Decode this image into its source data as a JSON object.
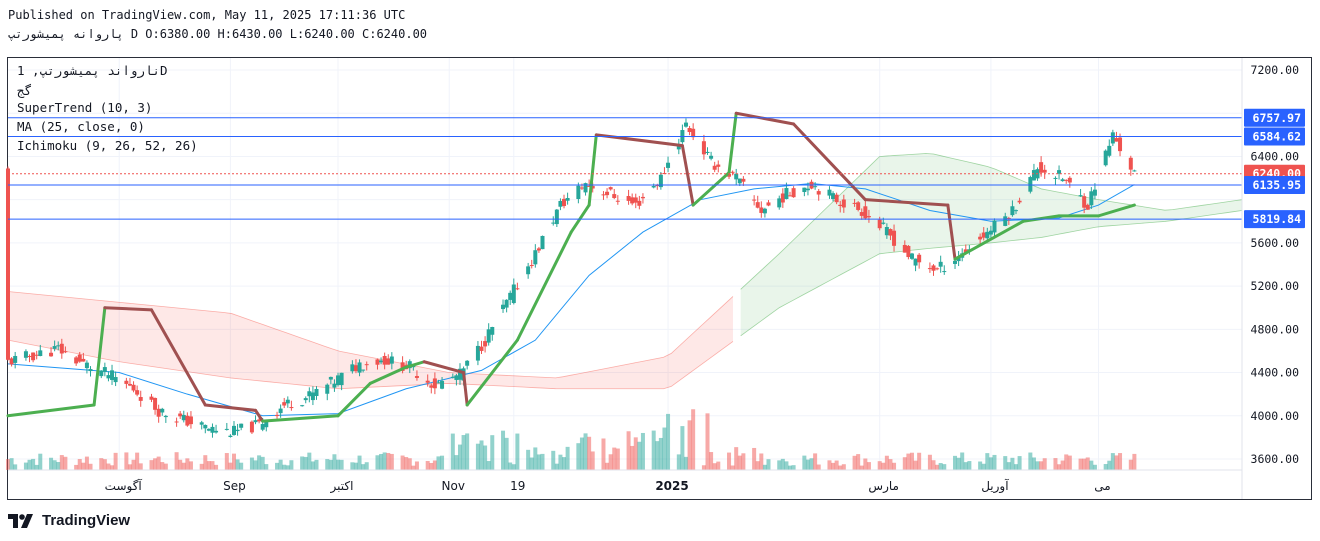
{
  "header": {
    "published": "Published on TradingView.com, May 11, 2025 17:11:36 UTC",
    "symbol_line": "پاروانه پمیشورتپ D O:6380.00 H:6430.00 L:6240.00 C:6240.00"
  },
  "legend": {
    "symbol": "نارواند پمیشورتپ, 1D",
    "exchange": "گج",
    "supertrend": "SuperTrend (10, 3)",
    "ma": "MA (25, close, 0)",
    "ichimoku": "Ichimoku (9, 26, 52, 26)"
  },
  "logo": {
    "text": "TradingView"
  },
  "colors": {
    "up": "#26a69a",
    "down": "#ef5350",
    "supertrend_up": "#4caf50",
    "supertrend_down": "#a05050",
    "ma": "#2196f3",
    "hline": "#2962ff"
  },
  "chart_data": {
    "type": "candlestick",
    "y_axis": {
      "position": "right",
      "ticks": [
        3600,
        4000,
        4400,
        4800,
        5200,
        5600,
        6000,
        6400,
        6800,
        7200
      ],
      "tick_labels": [
        "3600.00",
        "4000.00",
        "4400.00",
        "4800.00",
        "5200.00",
        "5600.00",
        "",
        "6400.00",
        "",
        "7200.00"
      ]
    },
    "x_axis": {
      "labels": [
        "آگوست",
        "Sep",
        "اکتبر",
        "Nov",
        "19",
        "2025",
        "مارس",
        "آوریل",
        "می"
      ],
      "label_dates": [
        "2024-08-01",
        "2024-09-01",
        "2024-10-01",
        "2024-11-01",
        "2024-11-19",
        "2025-01-01",
        "2025-03-01",
        "2025-04-01",
        "2025-05-01"
      ]
    },
    "price_labels": [
      {
        "value": 6757.97,
        "text": "6757.97",
        "color": "#2962ff"
      },
      {
        "value": 6584.62,
        "text": "6584.62",
        "color": "#2962ff"
      },
      {
        "value": 6240.0,
        "text": "6240.00",
        "color": "#ef5350"
      },
      {
        "value": 6135.95,
        "text": "6135.95",
        "color": "#2962ff"
      },
      {
        "value": 5819.84,
        "text": "5819.84",
        "color": "#2962ff"
      }
    ],
    "horizontal_lines": [
      6757.97,
      6584.62,
      6135.95,
      5819.84
    ],
    "last_close": 6240.0,
    "close_path": [
      [
        "2024-07-01",
        4500
      ],
      [
        "2024-07-08",
        4560
      ],
      [
        "2024-07-15",
        4620
      ],
      [
        "2024-07-22",
        4480
      ],
      [
        "2024-07-29",
        4380
      ],
      [
        "2024-08-05",
        4250
      ],
      [
        "2024-08-12",
        4050
      ],
      [
        "2024-08-19",
        3960
      ],
      [
        "2024-08-26",
        3880
      ],
      [
        "2024-09-02",
        3850
      ],
      [
        "2024-09-09",
        3920
      ],
      [
        "2024-09-16",
        4100
      ],
      [
        "2024-09-23",
        4180
      ],
      [
        "2024-09-30",
        4320
      ],
      [
        "2024-10-07",
        4480
      ],
      [
        "2024-10-14",
        4520
      ],
      [
        "2024-10-21",
        4450
      ],
      [
        "2024-10-28",
        4280
      ],
      [
        "2024-11-04",
        4380
      ],
      [
        "2024-11-11",
        4700
      ],
      [
        "2024-11-18",
        5100
      ],
      [
        "2024-11-25",
        5500
      ],
      [
        "2024-12-02",
        5950
      ],
      [
        "2024-12-09",
        6150
      ],
      [
        "2024-12-16",
        6050
      ],
      [
        "2024-12-23",
        5950
      ],
      [
        "2024-12-30",
        6200
      ],
      [
        "2025-01-06",
        6700
      ],
      [
        "2025-01-13",
        6350
      ],
      [
        "2025-01-20",
        6200
      ],
      [
        "2025-01-27",
        5900
      ],
      [
        "2025-02-03",
        6050
      ],
      [
        "2025-02-10",
        6150
      ],
      [
        "2025-02-17",
        6000
      ],
      [
        "2025-02-24",
        5900
      ],
      [
        "2025-03-03",
        5700
      ],
      [
        "2025-03-10",
        5450
      ],
      [
        "2025-03-17",
        5350
      ],
      [
        "2025-03-24",
        5500
      ],
      [
        "2025-03-31",
        5700
      ],
      [
        "2025-04-07",
        5900
      ],
      [
        "2025-04-14",
        6300
      ],
      [
        "2025-04-21",
        6200
      ],
      [
        "2025-04-28",
        5950
      ],
      [
        "2025-05-05",
        6600
      ],
      [
        "2025-05-11",
        6240
      ]
    ],
    "ma_path": [
      [
        "2024-07-01",
        4480
      ],
      [
        "2024-08-01",
        4400
      ],
      [
        "2024-08-20",
        4200
      ],
      [
        "2024-09-10",
        4000
      ],
      [
        "2024-10-01",
        4020
      ],
      [
        "2024-10-20",
        4250
      ],
      [
        "2024-11-10",
        4420
      ],
      [
        "2024-11-25",
        4700
      ],
      [
        "2024-12-10",
        5300
      ],
      [
        "2024-12-25",
        5700
      ],
      [
        "2025-01-10",
        6000
      ],
      [
        "2025-01-25",
        6100
      ],
      [
        "2025-02-10",
        6150
      ],
      [
        "2025-02-25",
        6100
      ],
      [
        "2025-03-15",
        5900
      ],
      [
        "2025-04-01",
        5800
      ],
      [
        "2025-04-20",
        5830
      ],
      [
        "2025-05-01",
        5950
      ],
      [
        "2025-05-11",
        6140
      ]
    ],
    "supertrend_path": [
      [
        "2024-07-01",
        4000,
        "up"
      ],
      [
        "2024-07-25",
        4100,
        "up"
      ],
      [
        "2024-07-28",
        5000,
        "down"
      ],
      [
        "2024-08-10",
        4980,
        "down"
      ],
      [
        "2024-08-25",
        4100,
        "down"
      ],
      [
        "2024-09-08",
        4050,
        "down"
      ],
      [
        "2024-09-10",
        3950,
        "up"
      ],
      [
        "2024-10-01",
        4000,
        "up"
      ],
      [
        "2024-10-10",
        4300,
        "up"
      ],
      [
        "2024-10-20",
        4450,
        "up"
      ],
      [
        "2024-10-25",
        4500,
        "down"
      ],
      [
        "2024-11-05",
        4400,
        "down"
      ],
      [
        "2024-11-06",
        4100,
        "up"
      ],
      [
        "2024-11-20",
        4700,
        "up"
      ],
      [
        "2024-12-05",
        5700,
        "up"
      ],
      [
        "2024-12-10",
        5950,
        "up"
      ],
      [
        "2024-12-12",
        6600,
        "down"
      ],
      [
        "2025-01-05",
        6500,
        "down"
      ],
      [
        "2025-01-08",
        5950,
        "up"
      ],
      [
        "2025-01-18",
        6250,
        "up"
      ],
      [
        "2025-01-20",
        6800,
        "down"
      ],
      [
        "2025-02-05",
        6700,
        "down"
      ],
      [
        "2025-02-25",
        6000,
        "down"
      ],
      [
        "2025-03-20",
        5950,
        "down"
      ],
      [
        "2025-03-22",
        5450,
        "up"
      ],
      [
        "2025-04-10",
        5800,
        "up"
      ],
      [
        "2025-04-20",
        5850,
        "up"
      ],
      [
        "2025-05-01",
        5850,
        "up"
      ],
      [
        "2025-05-11",
        5950,
        "up"
      ]
    ],
    "cloud_upper": [
      [
        "2024-07-01",
        5150
      ],
      [
        "2024-08-01",
        5050
      ],
      [
        "2024-09-01",
        4950
      ],
      [
        "2024-10-01",
        4600
      ],
      [
        "2024-11-01",
        4400
      ],
      [
        "2024-12-01",
        4350
      ],
      [
        "2025-01-01",
        4550
      ],
      [
        "2025-02-01",
        5500
      ],
      [
        "2025-03-01",
        6400
      ],
      [
        "2025-03-15",
        6430
      ],
      [
        "2025-04-01",
        6300
      ],
      [
        "2025-04-15",
        6100
      ],
      [
        "2025-05-01",
        6000
      ],
      [
        "2025-05-20",
        5900
      ],
      [
        "2025-06-10",
        6000
      ]
    ],
    "cloud_lower": [
      [
        "2024-07-01",
        4700
      ],
      [
        "2024-08-01",
        4500
      ],
      [
        "2024-09-01",
        4350
      ],
      [
        "2024-10-01",
        4250
      ],
      [
        "2024-11-01",
        4300
      ],
      [
        "2024-12-01",
        4250
      ],
      [
        "2025-01-01",
        4250
      ],
      [
        "2025-02-01",
        5000
      ],
      [
        "2025-03-01",
        5500
      ],
      [
        "2025-03-15",
        5550
      ],
      [
        "2025-04-01",
        5600
      ],
      [
        "2025-04-15",
        5650
      ],
      [
        "2025-05-01",
        5750
      ],
      [
        "2025-05-20",
        5800
      ],
      [
        "2025-06-10",
        5900
      ]
    ]
  }
}
